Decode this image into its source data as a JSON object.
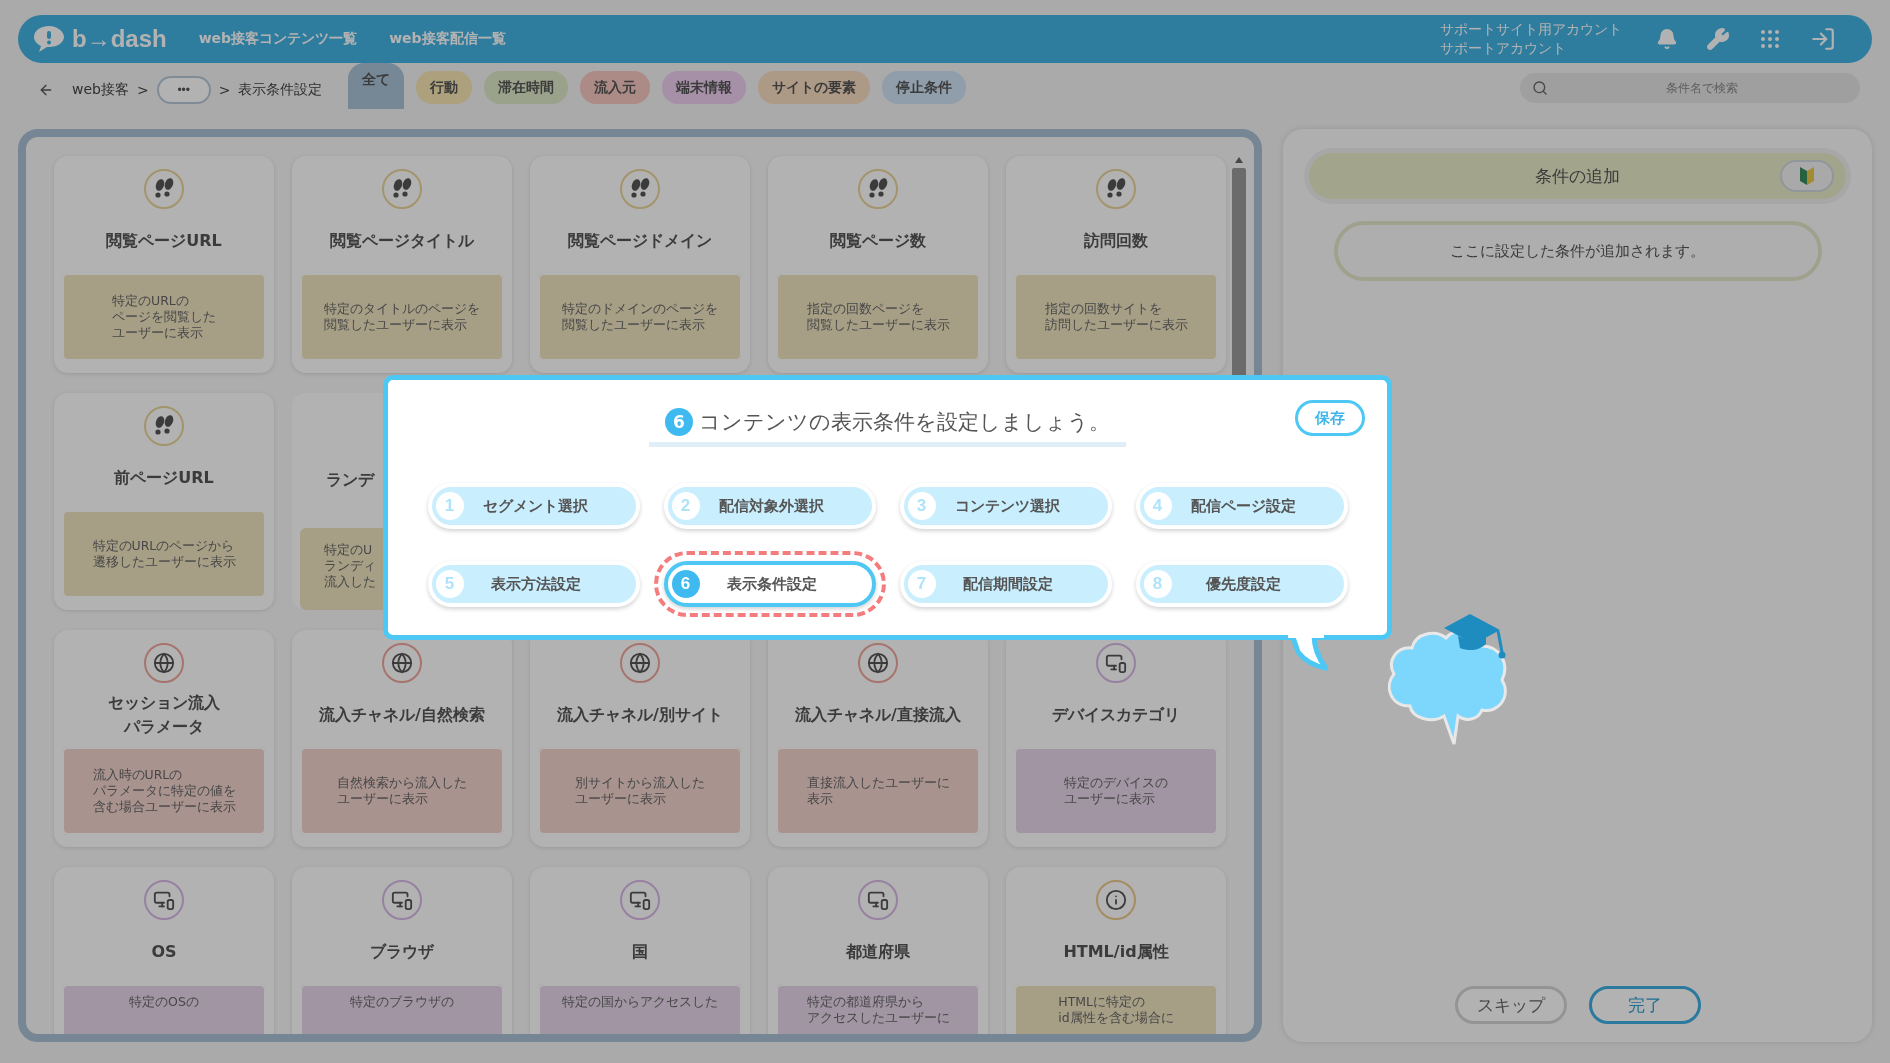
{
  "header": {
    "logo": "b→dash",
    "nav": [
      "web接客コンテンツ一覧",
      "web接客配信一覧"
    ],
    "account": [
      "サポートサイト用アカウント",
      "サポートアカウント"
    ]
  },
  "breadcrumb": [
    {
      "kind": "link",
      "label": "web接客"
    },
    {
      "kind": "separator",
      "label": ">"
    },
    {
      "kind": "more",
      "label": "•••"
    },
    {
      "kind": "separator",
      "label": ">"
    },
    {
      "kind": "current",
      "label": "表示条件設定"
    }
  ],
  "tabs": [
    {
      "label": "全て",
      "selected": true,
      "color": "#768796"
    },
    {
      "label": "行動",
      "selected": false,
      "color": "#aca07d"
    },
    {
      "label": "滞在時間",
      "selected": false,
      "color": "#9ba28b"
    },
    {
      "label": "流入元",
      "selected": false,
      "color": "#ac8b87"
    },
    {
      "label": "端末情報",
      "selected": false,
      "color": "#a590a8"
    },
    {
      "label": "サイトの要素",
      "selected": false,
      "color": "#ad9a86"
    },
    {
      "label": "停止条件",
      "selected": false,
      "color": "#909daa"
    }
  ],
  "search": {
    "placeholder": "条件名で検索"
  },
  "card_rows": [
    [
      {
        "kind": "footprints",
        "title": [
          "閲覧ページURL"
        ],
        "description": [
          "特定のURLの",
          "ページを閲覧した",
          "ユーザーに表示"
        ]
      },
      {
        "kind": "footprints",
        "title": [
          "閲覧ページタイトル"
        ],
        "description": [
          "特定のタイトルのページを",
          "閲覧したユーザーに表示"
        ]
      },
      {
        "kind": "footprints",
        "title": [
          "閲覧ページドメイン"
        ],
        "description": [
          "特定のドメインのページを",
          "閲覧したユーザーに表示"
        ]
      },
      {
        "kind": "footprints",
        "title": [
          "閲覧ページ数"
        ],
        "description": [
          "指定の回数ページを",
          "閲覧したユーザーに表示"
        ]
      },
      {
        "kind": "footprints",
        "title": [
          "訪問回数"
        ],
        "description": [
          "指定の回数サイトを",
          "訪問したユーザーに表示"
        ]
      }
    ],
    [
      {
        "kind": "footprints",
        "title": [
          "前ページURL"
        ],
        "description": [
          "特定のURLのページから",
          "遷移したユーザーに表示"
        ]
      }
    ],
    [
      {
        "kind": "globe",
        "title": [
          "セッション流入",
          "パラメータ"
        ],
        "description": [
          "流入時のURLの",
          "パラメータに特定の値を",
          "含む場合ユーザーに表示"
        ]
      },
      {
        "kind": "globe",
        "title": [
          "流入チャネル/自然検索"
        ],
        "description": [
          "自然検索から流入した",
          "ユーザーに表示"
        ]
      },
      {
        "kind": "globe",
        "title": [
          "流入チャネル/別サイト"
        ],
        "description": [
          "別サイトから流入した",
          "ユーザーに表示"
        ]
      },
      {
        "kind": "globe",
        "title": [
          "流入チャネル/直接流入"
        ],
        "description": [
          "直接流入したユーザーに",
          "表示"
        ]
      },
      {
        "kind": "device",
        "title": [
          "デバイスカテゴリ"
        ],
        "description": [
          "特定のデバイスの",
          "ユーザーに表示"
        ]
      }
    ],
    [
      {
        "kind": "device",
        "title": [
          "OS"
        ],
        "description": [
          "特定のOSの"
        ]
      },
      {
        "kind": "device",
        "title": [
          "ブラウザ"
        ],
        "description": [
          "特定のブラウザの"
        ]
      },
      {
        "kind": "device",
        "title": [
          "国"
        ],
        "description": [
          "特定の国からアクセスした"
        ]
      },
      {
        "kind": "device",
        "title": [
          "都道府県"
        ],
        "description": [
          "特定の都道府県から",
          "アクセスしたユーザーに"
        ]
      },
      {
        "kind": "info",
        "title": [
          "HTML/id属性"
        ],
        "description": [
          "HTMLに特定の",
          "id属性を含む場合に"
        ]
      }
    ]
  ],
  "covered_card": {
    "title": "ランデ",
    "description": [
      "特定のU",
      "ランディ",
      "流入した"
    ]
  },
  "popup": {
    "step_number": "6",
    "title": "コンテンツの表示条件を設定しましょう。",
    "save": "保存",
    "steps": [
      {
        "number": "1",
        "label": "セグメント選択",
        "selected": false
      },
      {
        "number": "2",
        "label": "配信対象外選択",
        "selected": false
      },
      {
        "number": "3",
        "label": "コンテンツ選択",
        "selected": false
      },
      {
        "number": "4",
        "label": "配信ページ設定",
        "selected": false
      },
      {
        "number": "5",
        "label": "表示方法設定",
        "selected": false
      },
      {
        "number": "6",
        "label": "表示条件設定",
        "selected": true
      },
      {
        "number": "7",
        "label": "配信期間設定",
        "selected": false
      },
      {
        "number": "8",
        "label": "優先度設定",
        "selected": false
      }
    ]
  },
  "right_panel": {
    "title": "条件の追加",
    "empty_message": "ここに設定した条件が追加されます。",
    "buttons": [
      {
        "kind": "secondary",
        "label": "スキップ"
      },
      {
        "kind": "primary",
        "label": "完了"
      }
    ]
  }
}
